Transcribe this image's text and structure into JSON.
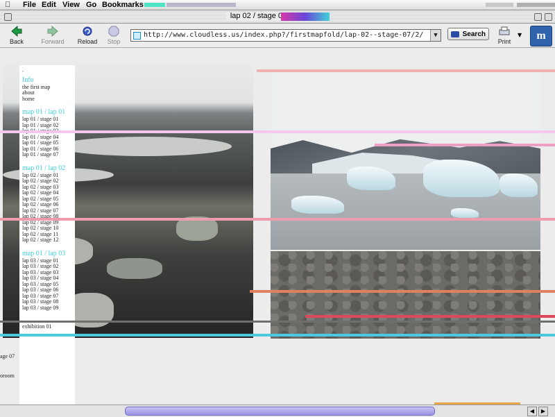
{
  "menubar": {
    "items": [
      "File",
      "Edit",
      "View",
      "Go",
      "Bookmarks"
    ]
  },
  "window": {
    "title": "lap 02 / stage 07 : cloudless"
  },
  "toolbar": {
    "back": "Back",
    "forward": "Forward",
    "reload": "Reload",
    "stop": "Stop",
    "url": "http://www.cloudless.us/index.php?/firstmapfold/lap-02--stage-07/2/",
    "search": "Search",
    "print": "Print"
  },
  "nav": {
    "dot": ".",
    "info_heading": "Info",
    "info_links": [
      "the first map",
      "about",
      "home"
    ],
    "lap01_heading": "map 01 / lap 01",
    "lap01": [
      "lap 01 / stage 01",
      "lap 01 / stage 02",
      "lap 01 / stage 03",
      "lap 01 / stage 04",
      "lap 01 / stage 05",
      "lap 01 / stage 06",
      "lap 01 / stage 07"
    ],
    "lap02_heading": "map 01 / lap 02",
    "lap02": [
      "lap 02 / stage 01",
      "lap 02 / stage 02",
      "lap 02 / stage 03",
      "lap 02 / stage 04",
      "lap 02 / stage 05",
      "lap 02 / stage 06",
      "lap 02 / stage 07",
      "lap 02 / stage 08",
      "lap 02 / stage 09",
      "lap 02 / stage 10",
      "lap 02 / stage 11",
      "lap 02 / stage 12"
    ],
    "lap03_heading": "map 01 / lap 03",
    "lap03": [
      "lap 03 / stage 01",
      "lap 03 / stage 02",
      "lap 03 / stage 03",
      "lap 03 / stage 04",
      "lap 03 / stage 05",
      "lap 03 / stage 06",
      "lap 03 / stage 07",
      "lap 03 / stage 08",
      "lap 03 / stage 09"
    ],
    "exhibition": "exhibition 01"
  },
  "offscreen": {
    "a": "age 07",
    "b": "oroom"
  },
  "colors": {
    "nav_heading": "#3fd2d9",
    "scroll_thumb": "#a49ce8"
  }
}
